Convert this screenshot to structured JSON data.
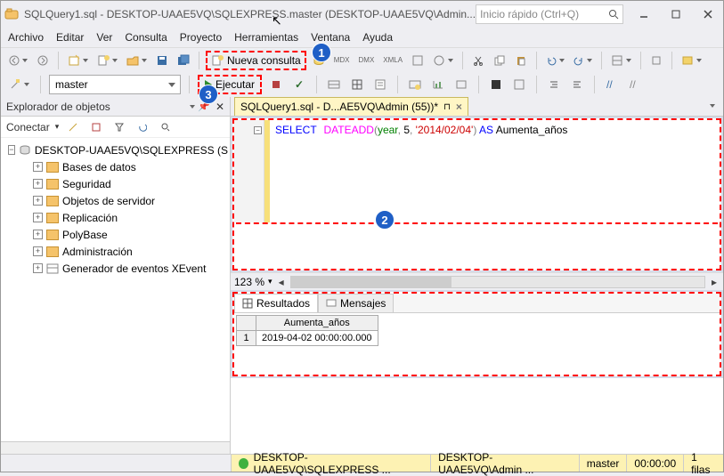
{
  "window": {
    "title": "SQLQuery1.sql - DESKTOP-UAAE5VQ\\SQLEXPRESS.master (DESKTOP-UAAE5VQ\\Admin...",
    "quick_launch_placeholder": "Inicio rápido (Ctrl+Q)"
  },
  "menu": {
    "items": [
      "Archivo",
      "Editar",
      "Ver",
      "Consulta",
      "Proyecto",
      "Herramientas",
      "Ventana",
      "Ayuda"
    ]
  },
  "toolbar": {
    "nueva_consulta": "Nueva consulta",
    "ejecutar": "Ejecutar",
    "database": "master",
    "zoom": "123 %"
  },
  "object_explorer": {
    "title": "Explorador de objetos",
    "connect_label": "Conectar",
    "root": "DESKTOP-UAAE5VQ\\SQLEXPRESS (S",
    "nodes": [
      "Bases de datos",
      "Seguridad",
      "Objetos de servidor",
      "Replicación",
      "PolyBase",
      "Administración",
      "Generador de eventos XEvent"
    ]
  },
  "editor": {
    "tab_title": "SQLQuery1.sql - D...AE5VQ\\Admin (55))*",
    "sql_tokens": {
      "select": "SELECT",
      "func": "DATEADD",
      "lp": "(",
      "arg1": "year",
      "comma1": ",",
      "arg2": " 5",
      "comma2": ",",
      "arg3": " '2014/02/04'",
      "rp": ")",
      "as": " AS",
      "alias": " Aumenta_años"
    }
  },
  "results": {
    "tab_results": "Resultados",
    "tab_messages": "Mensajes",
    "col1": "Aumenta_años",
    "row1_num": "1",
    "row1_val": "2019-04-02 00:00:00.000"
  },
  "statusbar": {
    "server": "DESKTOP-UAAE5VQ\\SQLEXPRESS ...",
    "login": "DESKTOP-UAAE5VQ\\Admin ...",
    "db": "master",
    "time": "00:00:00",
    "rows": "1 filas"
  },
  "annotations": {
    "n1": "1",
    "n2": "2",
    "n3": "3"
  }
}
